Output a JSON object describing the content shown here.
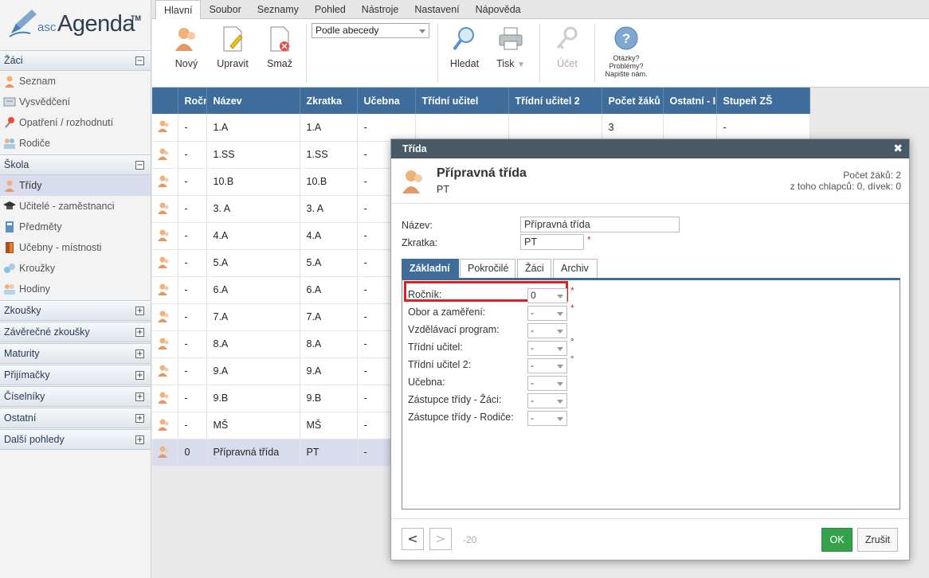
{
  "logo": {
    "asc": "asc",
    "agenda": "Agenda",
    "tm": "TM"
  },
  "sidebar": {
    "sections": [
      {
        "label": "Žáci",
        "toggle": "−",
        "items": [
          {
            "label": "Seznam",
            "icon": "people-icon"
          },
          {
            "label": "Vysvědčení",
            "icon": "certificate-icon"
          },
          {
            "label": "Opatření / rozhodnutí",
            "icon": "pin-icon"
          },
          {
            "label": "Rodiče",
            "icon": "parents-icon"
          }
        ]
      },
      {
        "label": "Škola",
        "toggle": "−",
        "items": [
          {
            "label": "Třídy",
            "icon": "class-icon",
            "active": true
          },
          {
            "label": "Učitelé - zaměstnanci",
            "icon": "graduation-cap-icon"
          },
          {
            "label": "Předměty",
            "icon": "book-icon"
          },
          {
            "label": "Učebny - místnosti",
            "icon": "door-icon"
          },
          {
            "label": "Kroužky",
            "icon": "puzzle-icon"
          },
          {
            "label": "Hodiny",
            "icon": "group-icon"
          }
        ]
      },
      {
        "label": "Zkoušky",
        "toggle": "+"
      },
      {
        "label": "Závěrečné zkoušky",
        "toggle": "+"
      },
      {
        "label": "Maturity",
        "toggle": "+"
      },
      {
        "label": "Přijímačky",
        "toggle": "+"
      },
      {
        "label": "Číselníky",
        "toggle": "+"
      },
      {
        "label": "Ostatní",
        "toggle": "+"
      },
      {
        "label": "Další pohledy",
        "toggle": "+"
      }
    ]
  },
  "menu": {
    "tabs": [
      "Hlavní",
      "Soubor",
      "Seznamy",
      "Pohled",
      "Nástroje",
      "Nastavení",
      "Nápověda"
    ]
  },
  "ribbon": {
    "new": "Nový",
    "edit": "Upravit",
    "delete": "Smaž",
    "sort": "Podle abecedy",
    "search": "Hledat",
    "print": "Tisk",
    "account": "Účet",
    "help": [
      "Otázky?",
      "Problémy?",
      "Napište nám."
    ]
  },
  "grid": {
    "headers": [
      "Ročník",
      "Název",
      "Zkratka",
      "Učebna",
      "Třídní učitel",
      "Třídní učitel 2",
      "Počet žáků",
      "Ostatní - IP",
      "Stupeň ZŠ"
    ],
    "rows": [
      {
        "rocnik": "-",
        "nazev": "1.A",
        "zkratka": "1.A",
        "ucebna": "-",
        "ucitel": "",
        "ucitel2": "",
        "pocet": "3",
        "ostatni": "",
        "stupen": "-"
      },
      {
        "rocnik": "-",
        "nazev": "1.SS",
        "zkratka": "1.SS",
        "ucebna": "-"
      },
      {
        "rocnik": "-",
        "nazev": "10.B",
        "zkratka": "10.B",
        "ucebna": "-"
      },
      {
        "rocnik": "-",
        "nazev": "3. A",
        "zkratka": "3. A",
        "ucebna": "-"
      },
      {
        "rocnik": "-",
        "nazev": "4.A",
        "zkratka": "4.A",
        "ucebna": "-"
      },
      {
        "rocnik": "-",
        "nazev": "5.A",
        "zkratka": "5.A",
        "ucebna": "-"
      },
      {
        "rocnik": "-",
        "nazev": "6.A",
        "zkratka": "6.A",
        "ucebna": "-"
      },
      {
        "rocnik": "-",
        "nazev": "7.A",
        "zkratka": "7.A",
        "ucebna": "-"
      },
      {
        "rocnik": "-",
        "nazev": "8.A",
        "zkratka": "8.A",
        "ucebna": "-"
      },
      {
        "rocnik": "-",
        "nazev": "9.A",
        "zkratka": "9.A",
        "ucebna": "-"
      },
      {
        "rocnik": "-",
        "nazev": "9.B",
        "zkratka": "9.B",
        "ucebna": "-"
      },
      {
        "rocnik": "-",
        "nazev": "MŠ",
        "zkratka": "MŠ",
        "ucebna": "-"
      },
      {
        "rocnik": "0",
        "nazev": "Přípravná třída",
        "zkratka": "PT",
        "ucebna": "-",
        "selected": true
      }
    ]
  },
  "dialog": {
    "title": "Třída",
    "close": "✖",
    "name": "Přípravná třída",
    "abbr": "PT",
    "count_line1": "Počet žáků: 2",
    "count_line2": "z toho chlapců: 0, dívek: 0",
    "fields": {
      "name_label": "Název:",
      "name_value": "Přípravná třída",
      "abbr_label": "Zkratka:",
      "abbr_value": "PT",
      "required": "*"
    },
    "tabs": [
      "Základní",
      "Pokročilé",
      "Žáci",
      "Archiv"
    ],
    "basic": [
      {
        "label": "Ročník:",
        "value": "0",
        "mark": "*"
      },
      {
        "label": "Obor a zaměření:",
        "value": "-",
        "mark": "*"
      },
      {
        "label": "Vzdělávací program:",
        "value": "-",
        "mark": ""
      },
      {
        "label": "Třídní učitel:",
        "value": "-",
        "mark": "°"
      },
      {
        "label": "Třídní učitel 2:",
        "value": "-",
        "mark": "°"
      },
      {
        "label": "Učebna:",
        "value": "-",
        "mark": ""
      },
      {
        "label": "Zástupce třídy - Žáci:",
        "value": "-",
        "mark": ""
      },
      {
        "label": "Zástupce třídy - Rodiče:",
        "value": "-",
        "mark": ""
      }
    ],
    "footer": {
      "prev": "<",
      "next": ">",
      "page": "-20",
      "ok": "OK",
      "cancel": "Zrušit"
    }
  },
  "colors": {
    "accent": "#3e6d9c",
    "ok": "#36a14a",
    "highlight": "#e02020",
    "selected_row": "#d9dcec"
  }
}
